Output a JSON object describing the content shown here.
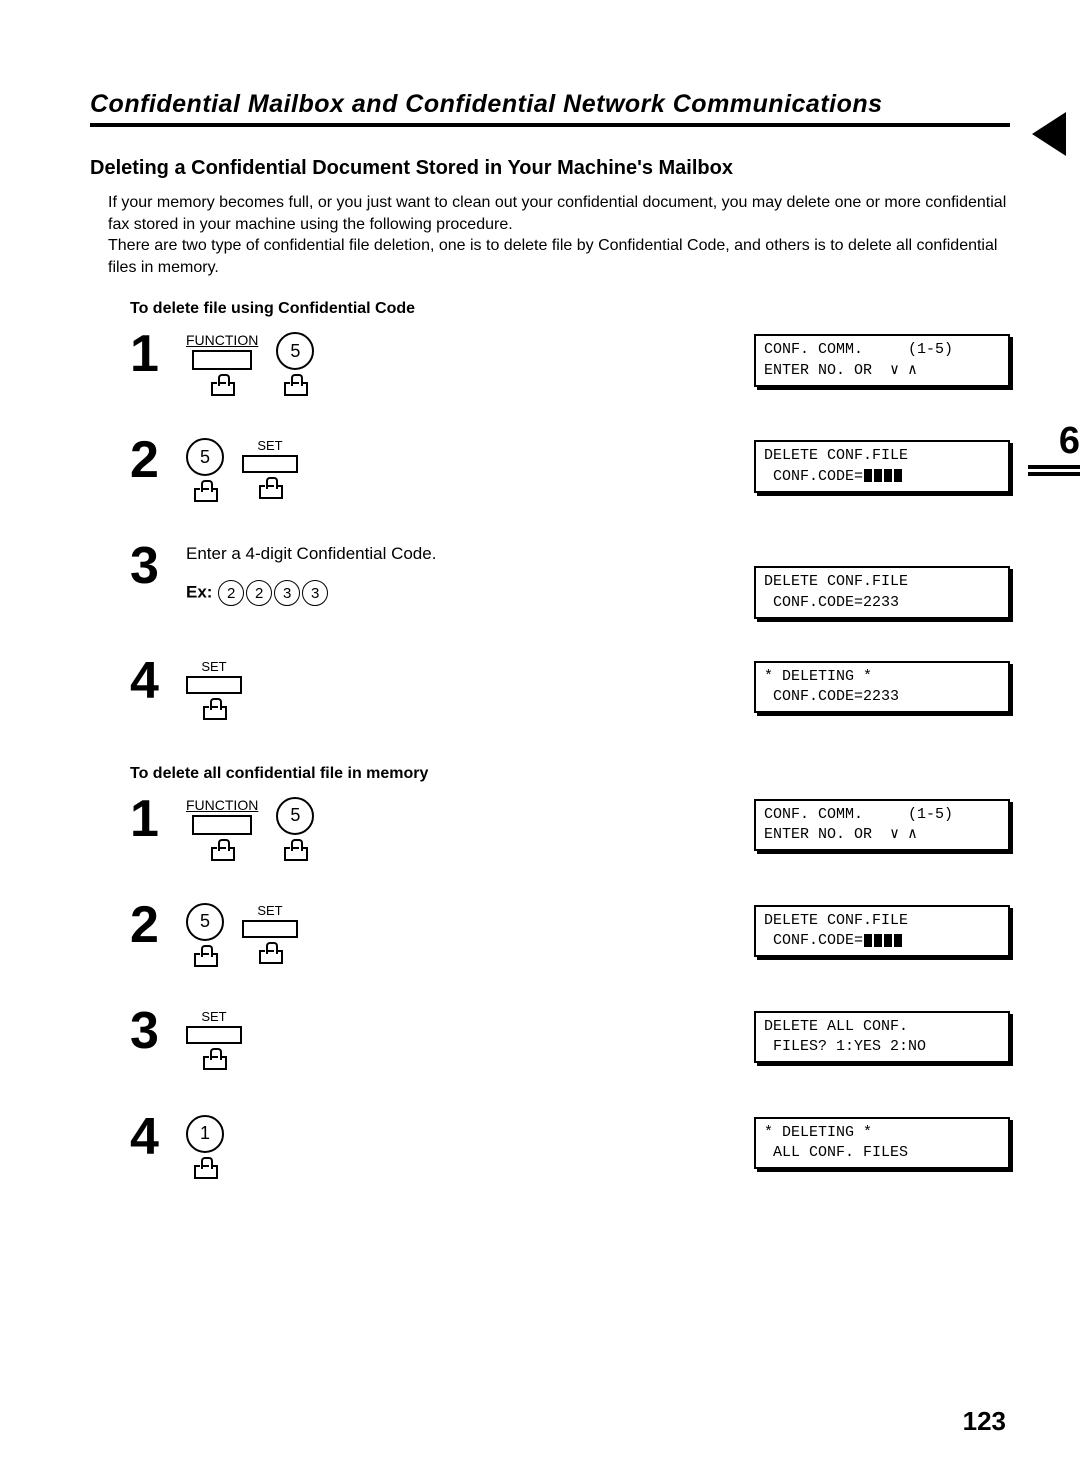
{
  "header": {
    "title": "Confidential Mailbox and Confidential Network Communications"
  },
  "section": {
    "title": "Deleting a Confidential Document Stored in Your Machine's Mailbox"
  },
  "intro": {
    "p1": "If your memory becomes full, or you just want to clean out your confidential document, you may delete one or more confidential fax stored in your machine using the following procedure.",
    "p2": "There are two type of confidential file deletion, one is to delete file by Confidential Code, and others is to delete all confidential files in memory."
  },
  "procA": {
    "heading": "To delete file using Confidential Code",
    "step1": {
      "lcd1": "CONF. COMM.     (1-5)",
      "lcd2": "ENTER NO. OR  ∨ ∧"
    },
    "step2": {
      "lcd1": "DELETE CONF.FILE",
      "lcd2": " CONF.CODE="
    },
    "step3": {
      "text": "Enter a 4-digit Confidential Code.",
      "ex_label": "Ex:",
      "digits": [
        "2",
        "2",
        "3",
        "3"
      ],
      "lcd1": "DELETE CONF.FILE",
      "lcd2": " CONF.CODE=2233"
    },
    "step4": {
      "lcd1": "* DELETING *",
      "lcd2": " CONF.CODE=2233"
    }
  },
  "procB": {
    "heading": "To delete all confidential file in memory",
    "step1": {
      "lcd1": "CONF. COMM.     (1-5)",
      "lcd2": "ENTER NO. OR  ∨ ∧"
    },
    "step2": {
      "lcd1": "DELETE CONF.FILE",
      "lcd2": " CONF.CODE="
    },
    "step3": {
      "lcd1": "DELETE ALL CONF.",
      "lcd2": " FILES? 1:YES 2:NO"
    },
    "step4": {
      "digit": "1",
      "lcd1": "* DELETING *",
      "lcd2": " ALL CONF. FILES"
    }
  },
  "keys": {
    "function": "FUNCTION",
    "set": "SET",
    "five": "5"
  },
  "chapter": "6",
  "page_number": "123"
}
